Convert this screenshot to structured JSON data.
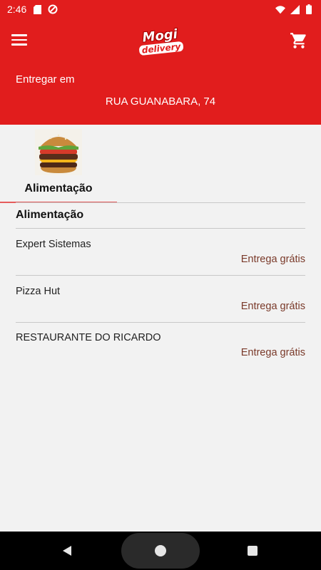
{
  "status_bar": {
    "time": "2:46",
    "icons": [
      "sd-card-icon",
      "data-saver-icon",
      "wifi-icon",
      "signal-icon",
      "battery-icon"
    ]
  },
  "toolbar": {
    "menu_icon": "hamburger-menu-icon",
    "logo_line1": "Mogi",
    "logo_line2": "delivery",
    "cart_icon": "cart-icon"
  },
  "delivery": {
    "label": "Entregar em",
    "address": "RUA GUANABARA, 74"
  },
  "categories": [
    {
      "label": "Alimentação",
      "image": "hamburger-image"
    }
  ],
  "section": {
    "title": "Alimentação"
  },
  "stores": [
    {
      "name": "Expert Sistemas",
      "delivery": "Entrega grátis"
    },
    {
      "name": "Pizza Hut",
      "delivery": "Entrega grátis"
    },
    {
      "name": "RESTAURANTE DO RICARDO",
      "delivery": "Entrega grátis"
    }
  ],
  "colors": {
    "brand_red": "#e11d1d",
    "background": "#f2f2f2",
    "delivery_text": "#7a3a2a"
  },
  "nav_bar": {
    "icons": [
      "back-icon",
      "home-icon",
      "recents-icon"
    ]
  }
}
